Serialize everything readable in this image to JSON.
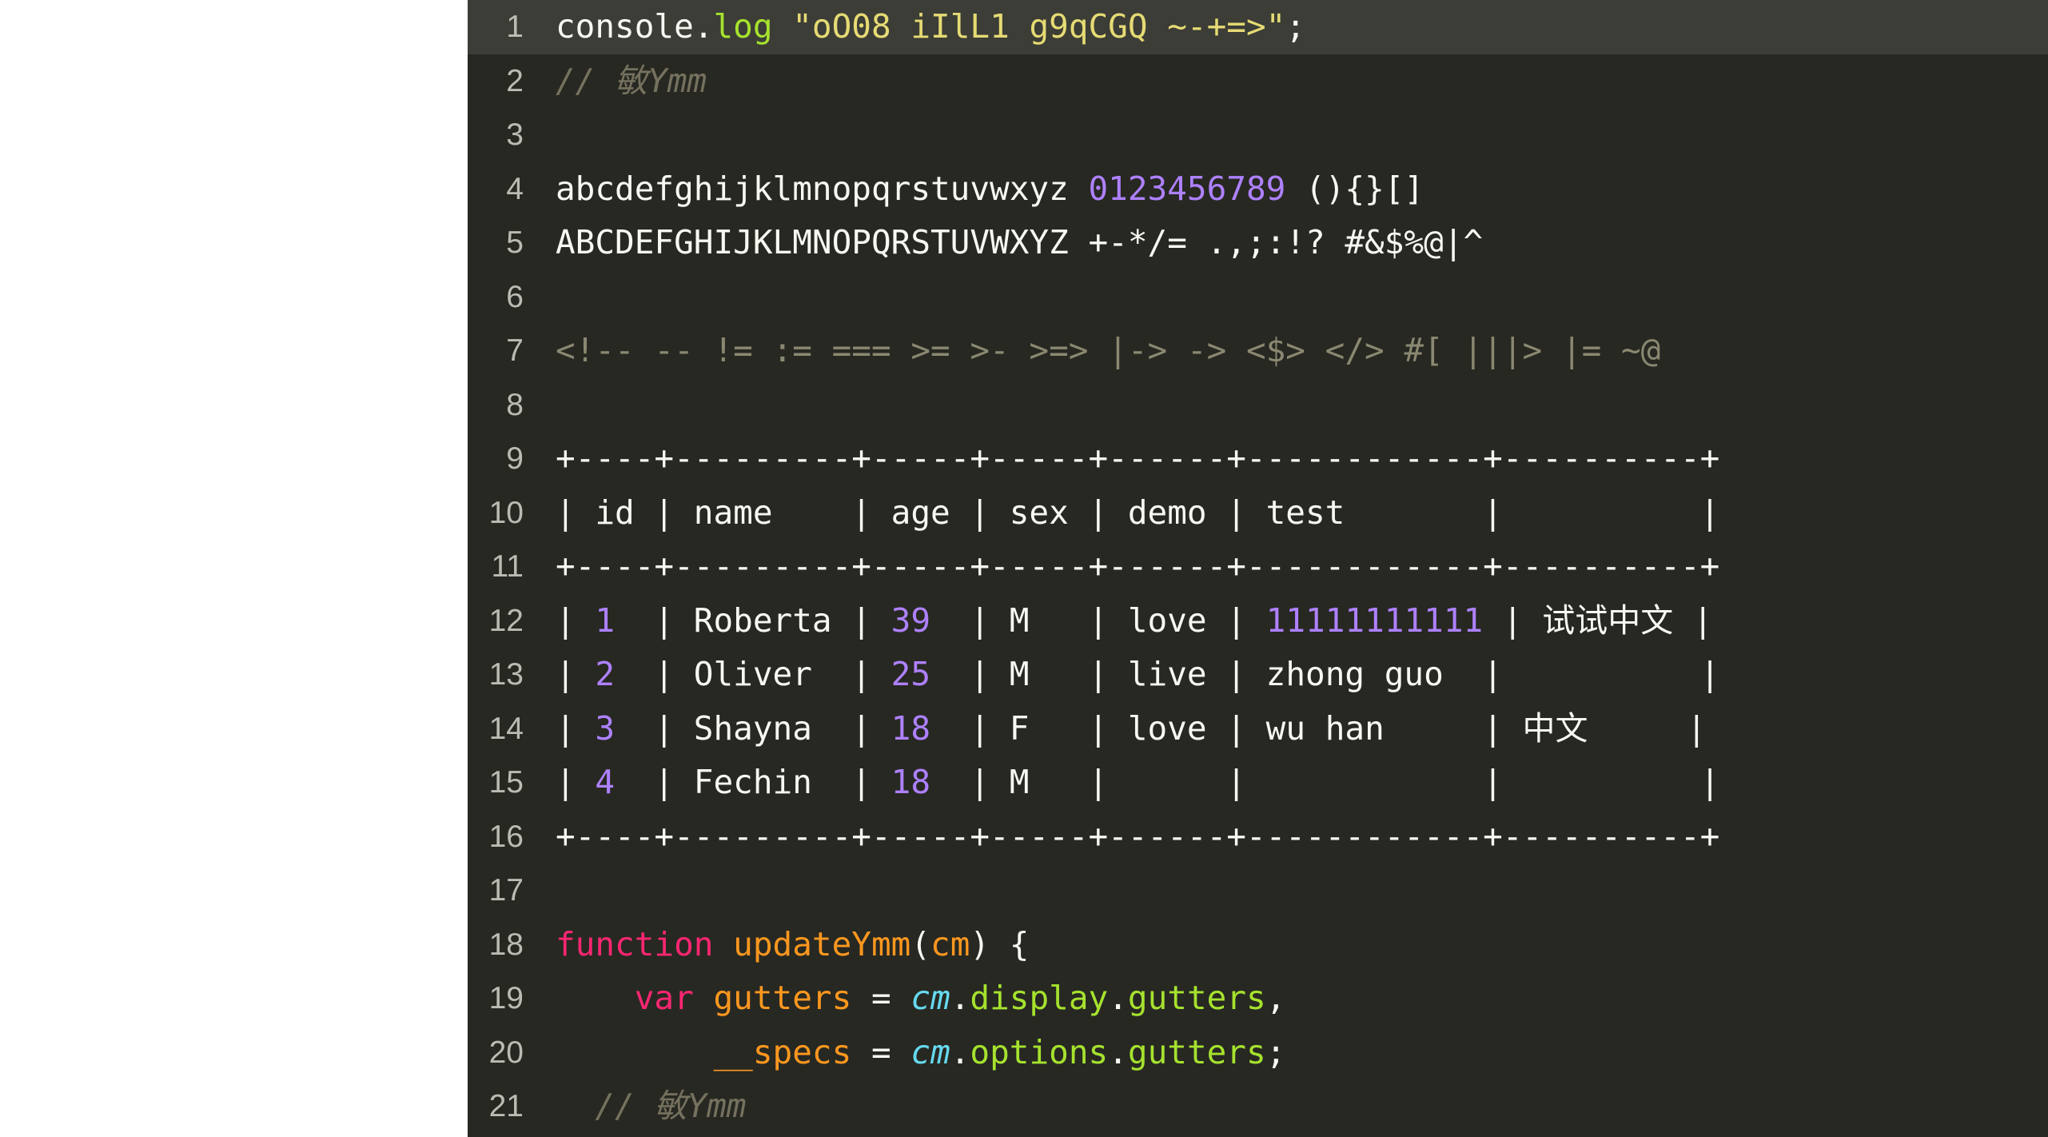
{
  "editor": {
    "theme_name": "monokai",
    "background": "#272822",
    "active_line_background": "#3c3d36",
    "gutter_text_color": "#c8c8c0",
    "default_text_color": "#f8f8f2",
    "page_background": "#ffffff",
    "first_visible_line": 1,
    "last_visible_line": 21,
    "colors": {
      "string": "#e6db74",
      "number": "#ae81ff",
      "comment": "#75715e",
      "operator_glyph": "#8a8871",
      "keyword": "#f92672",
      "function": "#fd971f",
      "variable": "#fd971f",
      "property": "#a6e22e",
      "builtin": "#66d9ef",
      "plain": "#f8f8f2"
    },
    "lines": [
      {
        "number": "1",
        "active": true,
        "tokens": [
          {
            "text": "console",
            "cls": "t-plain"
          },
          {
            "text": ".",
            "cls": "t-plain"
          },
          {
            "text": "log",
            "cls": "t-prop"
          },
          {
            "text": " ",
            "cls": "t-plain"
          },
          {
            "text": "\"oO08 iIlL1 g9qCGQ ~-+=>\"",
            "cls": "t-string"
          },
          {
            "text": ";",
            "cls": "t-plain"
          }
        ]
      },
      {
        "number": "2",
        "active": false,
        "tokens": [
          {
            "text": "// 敏Ymm",
            "cls": "t-comment"
          }
        ]
      },
      {
        "number": "3",
        "active": false,
        "tokens": []
      },
      {
        "number": "4",
        "active": false,
        "tokens": [
          {
            "text": "abcdefghijklmnopqrstuvwxyz ",
            "cls": "t-plain"
          },
          {
            "text": "0123456789",
            "cls": "t-number"
          },
          {
            "text": " ()",
            "cls": "t-plain"
          },
          {
            "text": "{}",
            "cls": "t-plain"
          },
          {
            "text": "[]",
            "cls": "t-plain"
          }
        ]
      },
      {
        "number": "5",
        "active": false,
        "tokens": [
          {
            "text": "ABCDEFGHIJKLMNOPQRSTUVWXYZ +-*/= .,;:!? #&$%@|^",
            "cls": "t-plain"
          }
        ]
      },
      {
        "number": "6",
        "active": false,
        "tokens": []
      },
      {
        "number": "7",
        "active": false,
        "tokens": [
          {
            "text": "<!-- -- != := === >= >- >=> |-> -> <$> </> #[ |||> |= ~@",
            "cls": "t-op"
          }
        ]
      },
      {
        "number": "8",
        "active": false,
        "tokens": []
      },
      {
        "number": "9",
        "active": false,
        "tokens": [
          {
            "text": "+----+---------+-----+-----+------+------------+----------+",
            "cls": "t-plain"
          }
        ]
      },
      {
        "number": "10",
        "active": false,
        "tokens": [
          {
            "text": "| id | name    | age | sex | demo | test       |          |",
            "cls": "t-plain"
          }
        ]
      },
      {
        "number": "11",
        "active": false,
        "tokens": [
          {
            "text": "+----+---------+-----+-----+------+------------+----------+",
            "cls": "t-plain"
          }
        ]
      },
      {
        "number": "12",
        "active": false,
        "tokens": [
          {
            "text": "| ",
            "cls": "t-plain"
          },
          {
            "text": "1",
            "cls": "t-number"
          },
          {
            "text": "  | Roberta | ",
            "cls": "t-plain"
          },
          {
            "text": "39",
            "cls": "t-number"
          },
          {
            "text": "  | M   | love | ",
            "cls": "t-plain"
          },
          {
            "text": "11111111111",
            "cls": "t-number"
          },
          {
            "text": " | 试试中文 |",
            "cls": "t-plain"
          }
        ]
      },
      {
        "number": "13",
        "active": false,
        "tokens": [
          {
            "text": "| ",
            "cls": "t-plain"
          },
          {
            "text": "2",
            "cls": "t-number"
          },
          {
            "text": "  | Oliver  | ",
            "cls": "t-plain"
          },
          {
            "text": "25",
            "cls": "t-number"
          },
          {
            "text": "  | M   | live | zhong guo  |          |",
            "cls": "t-plain"
          }
        ]
      },
      {
        "number": "14",
        "active": false,
        "tokens": [
          {
            "text": "| ",
            "cls": "t-plain"
          },
          {
            "text": "3",
            "cls": "t-number"
          },
          {
            "text": "  | Shayna  | ",
            "cls": "t-plain"
          },
          {
            "text": "18",
            "cls": "t-number"
          },
          {
            "text": "  | F   | love | wu han     | 中文     |",
            "cls": "t-plain"
          }
        ]
      },
      {
        "number": "15",
        "active": false,
        "tokens": [
          {
            "text": "| ",
            "cls": "t-plain"
          },
          {
            "text": "4",
            "cls": "t-number"
          },
          {
            "text": "  | Fechin  | ",
            "cls": "t-plain"
          },
          {
            "text": "18",
            "cls": "t-number"
          },
          {
            "text": "  | M   |      |            |          |",
            "cls": "t-plain"
          }
        ]
      },
      {
        "number": "16",
        "active": false,
        "tokens": [
          {
            "text": "+----+---------+-----+-----+------+------------+----------+",
            "cls": "t-plain"
          }
        ]
      },
      {
        "number": "17",
        "active": false,
        "tokens": []
      },
      {
        "number": "18",
        "active": false,
        "tokens": [
          {
            "text": "function",
            "cls": "t-kw"
          },
          {
            "text": " ",
            "cls": "t-plain"
          },
          {
            "text": "updateYmm",
            "cls": "t-fn"
          },
          {
            "text": "(",
            "cls": "t-plain"
          },
          {
            "text": "cm",
            "cls": "t-param"
          },
          {
            "text": ") {",
            "cls": "t-plain"
          }
        ]
      },
      {
        "number": "19",
        "active": false,
        "tokens": [
          {
            "text": "    ",
            "cls": "t-plain"
          },
          {
            "text": "var",
            "cls": "t-kw"
          },
          {
            "text": " ",
            "cls": "t-plain"
          },
          {
            "text": "gutters",
            "cls": "t-var"
          },
          {
            "text": " = ",
            "cls": "t-plain"
          },
          {
            "text": "cm",
            "cls": "t-cm"
          },
          {
            "text": ".",
            "cls": "t-plain"
          },
          {
            "text": "display",
            "cls": "t-prop"
          },
          {
            "text": ".",
            "cls": "t-plain"
          },
          {
            "text": "gutters",
            "cls": "t-prop"
          },
          {
            "text": ",",
            "cls": "t-plain"
          }
        ]
      },
      {
        "number": "20",
        "active": false,
        "tokens": [
          {
            "text": "        ",
            "cls": "t-plain"
          },
          {
            "text": "__specs",
            "cls": "t-var"
          },
          {
            "text": " = ",
            "cls": "t-plain"
          },
          {
            "text": "cm",
            "cls": "t-cm"
          },
          {
            "text": ".",
            "cls": "t-plain"
          },
          {
            "text": "options",
            "cls": "t-prop"
          },
          {
            "text": ".",
            "cls": "t-plain"
          },
          {
            "text": "gutters",
            "cls": "t-prop"
          },
          {
            "text": ";",
            "cls": "t-plain"
          }
        ]
      },
      {
        "number": "21",
        "active": false,
        "tokens": [
          {
            "text": "  // 敏Ymm",
            "cls": "t-comment"
          }
        ]
      }
    ]
  },
  "table_data": {
    "columns": [
      "id",
      "name",
      "age",
      "sex",
      "demo",
      "test",
      ""
    ],
    "rows": [
      {
        "id": "1",
        "name": "Roberta",
        "age": "39",
        "sex": "M",
        "demo": "love",
        "test": "11111111111",
        "extra": "试试中文"
      },
      {
        "id": "2",
        "name": "Oliver",
        "age": "25",
        "sex": "M",
        "demo": "live",
        "test": "zhong guo",
        "extra": ""
      },
      {
        "id": "3",
        "name": "Shayna",
        "age": "18",
        "sex": "F",
        "demo": "love",
        "test": "wu han",
        "extra": "中文"
      },
      {
        "id": "4",
        "name": "Fechin",
        "age": "18",
        "sex": "M",
        "demo": "",
        "test": "",
        "extra": ""
      }
    ]
  }
}
